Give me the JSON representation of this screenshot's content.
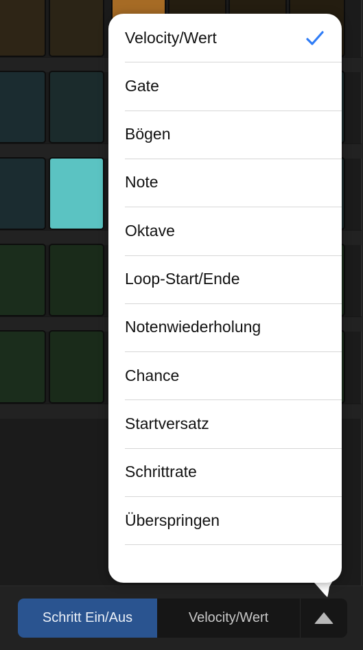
{
  "grid": {
    "rows": [
      {
        "name": "velocity-row",
        "pads": [
          {
            "color": "#2e2516",
            "active": false
          },
          {
            "color": "#2b2416",
            "active": false
          },
          {
            "color": "#a66b25",
            "active": true
          },
          {
            "color": "#241d10",
            "active": false
          },
          {
            "color": "#241d10",
            "active": false
          },
          {
            "color": "#241d10",
            "active": false
          }
        ]
      },
      {
        "name": "row-2",
        "pads": [
          {
            "color": "#1b2c30",
            "active": false
          },
          {
            "color": "#1b2b2c",
            "active": false
          },
          {
            "color": "#1b2b2c",
            "active": false
          },
          {
            "color": "#1b2b2c",
            "active": false
          },
          {
            "color": "#1b2b2c",
            "active": false
          },
          {
            "color": "#1b2b2c",
            "active": false
          }
        ]
      },
      {
        "name": "row-3",
        "pads": [
          {
            "color": "#1b2c30",
            "active": false
          },
          {
            "color": "#5bc3c2",
            "active": true
          },
          {
            "color": "#1b2b2c",
            "active": false
          },
          {
            "color": "#1b2b2c",
            "active": false
          },
          {
            "color": "#1b2b2c",
            "active": false
          },
          {
            "color": "#1b2b2c",
            "active": false
          }
        ]
      },
      {
        "name": "row-4",
        "pads": [
          {
            "color": "#1b2d1c",
            "active": false
          },
          {
            "color": "#1a2b1a",
            "active": false
          },
          {
            "color": "#1a2b1a",
            "active": false
          },
          {
            "color": "#1a2b1a",
            "active": false
          },
          {
            "color": "#1a2b1a",
            "active": false
          },
          {
            "color": "#1a2b1a",
            "active": false
          }
        ]
      },
      {
        "name": "row-5",
        "pads": [
          {
            "color": "#1b2d1c",
            "active": false
          },
          {
            "color": "#1a2b1a",
            "active": false
          },
          {
            "color": "#1a2b1a",
            "active": false
          },
          {
            "color": "#1a2b1a",
            "active": false
          },
          {
            "color": "#1a2b1a",
            "active": false
          },
          {
            "color": "#1a2b1a",
            "active": false
          }
        ]
      }
    ]
  },
  "popover": {
    "selected_index": 0,
    "check_icon": "checkmark-icon",
    "accent_color": "#2f7cf6",
    "items": [
      {
        "label": "Velocity/Wert"
      },
      {
        "label": "Gate"
      },
      {
        "label": "Bögen"
      },
      {
        "label": "Note"
      },
      {
        "label": "Oktave"
      },
      {
        "label": "Loop-Start/Ende"
      },
      {
        "label": "Notenwiederholung"
      },
      {
        "label": "Chance"
      },
      {
        "label": "Startversatz"
      },
      {
        "label": "Schrittrate"
      },
      {
        "label": "Überspringen"
      }
    ]
  },
  "toolbar": {
    "step_toggle_label": "Schritt Ein/Aus",
    "mode_label": "Velocity/Wert",
    "menu_toggle_icon": "triangle-up-icon",
    "active_color": "#2a5490"
  }
}
